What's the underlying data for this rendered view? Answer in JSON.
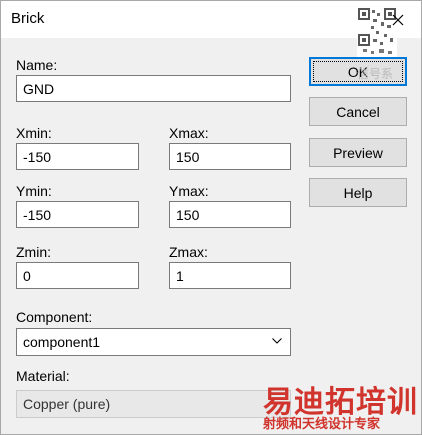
{
  "window": {
    "title": "Brick"
  },
  "fields": {
    "name": {
      "label": "Name:",
      "value": "GND"
    },
    "xmin": {
      "label": "Xmin:",
      "value": "-150"
    },
    "xmax": {
      "label": "Xmax:",
      "value": "150"
    },
    "ymin": {
      "label": "Ymin:",
      "value": "-150"
    },
    "ymax": {
      "label": "Ymax:",
      "value": "150"
    },
    "zmin": {
      "label": "Zmin:",
      "value": "0"
    },
    "zmax": {
      "label": "Zmax:",
      "value": "1"
    }
  },
  "component": {
    "label": "Component:",
    "value": "component1"
  },
  "material": {
    "label": "Material:",
    "value": "Copper (pure)"
  },
  "buttons": {
    "ok": "OK",
    "cancel": "Cancel",
    "preview": "Preview",
    "help": "Help"
  },
  "watermark": {
    "brand": "易迪拓培训",
    "tagline": "射频和天线设计专家",
    "faint": "信号系"
  },
  "icons": {
    "close": "close-icon",
    "dropdown": "chevron-down-icon",
    "qr": "qr-code-icon"
  }
}
